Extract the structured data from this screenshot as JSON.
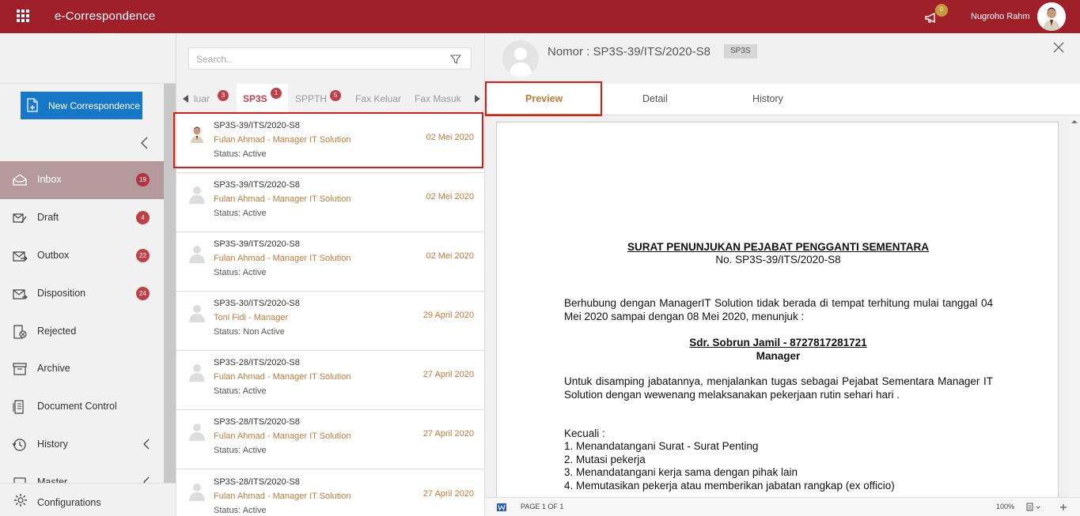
{
  "app": {
    "title": "e-Correspondence",
    "notification_count": "0",
    "user_name": "Nugroho Rahm"
  },
  "sidebar": {
    "new_button": "New Correspondence",
    "items": [
      {
        "label": "Inbox",
        "badge": "19",
        "icon": "inbox-icon",
        "active": true
      },
      {
        "label": "Draft",
        "badge": "4",
        "icon": "draft-icon"
      },
      {
        "label": "Outbox",
        "badge": "22",
        "icon": "outbox-icon"
      },
      {
        "label": "Disposition",
        "badge": "24",
        "icon": "disposition-icon"
      },
      {
        "label": "Rejected",
        "badge": "",
        "icon": "rejected-icon"
      },
      {
        "label": "Archive",
        "badge": "",
        "icon": "archive-icon"
      },
      {
        "label": "Document Control",
        "badge": "",
        "icon": "document-control-icon"
      },
      {
        "label": "History",
        "badge": "",
        "icon": "history-icon"
      },
      {
        "label": "Master",
        "badge": "",
        "icon": "master-icon"
      }
    ],
    "configurations": "Configurations"
  },
  "list_panel": {
    "search_placeholder": "Search..",
    "tabs": [
      {
        "label": "luar",
        "badge": "3"
      },
      {
        "label": "SP3S",
        "badge": "1",
        "active": true
      },
      {
        "label": "SPPTH",
        "badge": "5"
      },
      {
        "label": "Fax Keluar",
        "badge": ""
      },
      {
        "label": "Fax Masuk",
        "badge": ""
      }
    ],
    "items": [
      {
        "number": "SP3S-39/ITS/2020-S8",
        "sender": "Fulan Ahmad - Manager IT Solution",
        "status": "Status: Active",
        "date": "02 Mei 2020"
      },
      {
        "number": "SP3S-39/ITS/2020-S8",
        "sender": "Fulan Ahmad - Manager IT Solution",
        "status": "Status: Active",
        "date": "02 Mei 2020"
      },
      {
        "number": "SP3S-39/ITS/2020-S8",
        "sender": "Fulan Ahmad - Manager IT Solution",
        "status": "Status: Active",
        "date": "02 Mei 2020"
      },
      {
        "number": "SP3S-30/ITS/2020-S8",
        "sender": "Toni Fidi - Manager",
        "status": "Status: Non Active",
        "date": "29 April 2020"
      },
      {
        "number": "SP3S-28/ITS/2020-S8",
        "sender": "Fulan Ahmad - Manager IT Solution",
        "status": "Status: Active",
        "date": "27 April 2020"
      },
      {
        "number": "SP3S-28/ITS/2020-S8",
        "sender": "Fulan Ahmad - Manager IT Solution",
        "status": "Status: Active",
        "date": "27 April 2020"
      },
      {
        "number": "SP3S-28/ITS/2020-S8",
        "sender": "Fulan Ahmad - Manager IT Solution",
        "status": "Status: Active",
        "date": "27 April 2020"
      }
    ]
  },
  "detail": {
    "title": "Nomor : SP3S-39/ITS/2020-S8",
    "tag": "SP3S",
    "tabs": [
      "Preview",
      "Detail",
      "History"
    ],
    "document": {
      "title": "SURAT PENUNJUKAN PEJABAT PENGGANTI SEMENTARA",
      "number": "No. SP3S-39/ITS/2020-S8",
      "para1": "Berhubung dengan ManagerIT Solution tidak berada di tempat terhitung mulai tanggal 04 Mei 2020 sampai dengan 08 Mei 2020, menunjuk :",
      "appointee": "Sdr. Sobrun Jamil - 8727817281721",
      "appointee_role": "Manager",
      "para2": "Untuk disamping jabatannya, menjalankan tugas sebagai Pejabat Sementara Manager IT Solution dengan wewenang melaksanakan pekerjaan rutin sehari hari .",
      "except_label": "Kecuali :",
      "except_items": [
        "1. Menandatangani Surat - Surat Penting",
        "2. Mutasi pekerja",
        "3. Menandatangani kerja sama dengan pihak lain",
        "4. Memutasikan pekerja atau memberikan jabatan rangkap (ex officio)"
      ]
    },
    "status_bar": {
      "page": "PAGE 1 OF 1",
      "zoom": "100%"
    }
  }
}
